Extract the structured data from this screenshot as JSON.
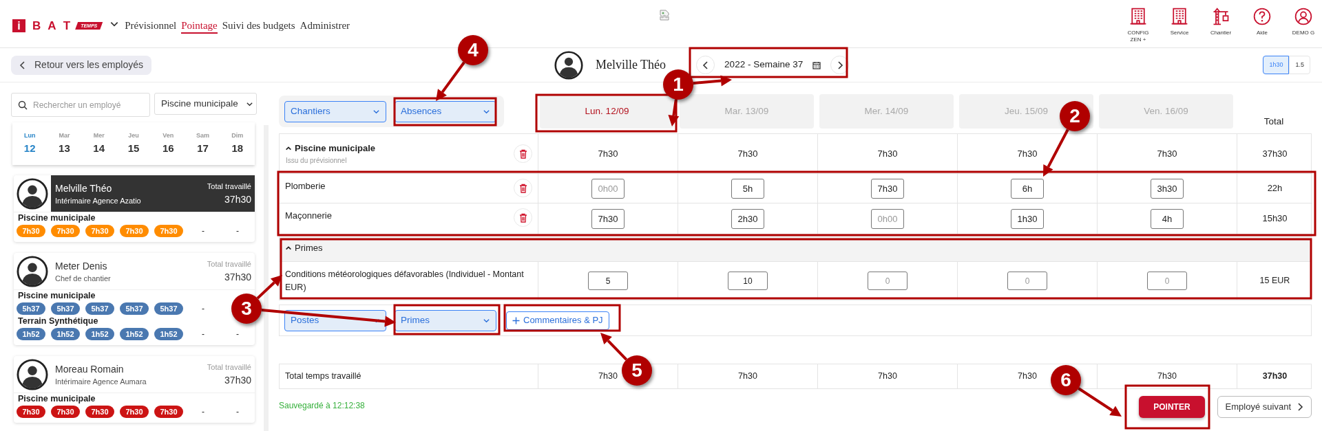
{
  "header": {
    "logo": {
      "letter": "i",
      "text": "B A T",
      "tag": "TEMPS"
    },
    "nav": [
      {
        "label": "Prévisionnel",
        "selected": false
      },
      {
        "label": "Pointage",
        "selected": true
      },
      {
        "label": "Suivi des budgets",
        "selected": false
      },
      {
        "label": "Administrer",
        "selected": false
      }
    ],
    "shortcuts": [
      {
        "label": "CONFIG ZEN +",
        "kind": "building"
      },
      {
        "label": "Service",
        "kind": "building"
      },
      {
        "label": "Chantier",
        "kind": "crane"
      },
      {
        "label": "Aide",
        "kind": "help"
      },
      {
        "label": "DEMO G",
        "kind": "user"
      }
    ]
  },
  "back_button": "Retour vers les employés",
  "employee_name": "Melville Théo",
  "week": "2022 - Semaine 37",
  "format_toggle": [
    {
      "label": "1h30",
      "selected": true
    },
    {
      "label": "1.5",
      "selected": false
    }
  ],
  "sidebar": {
    "search": {
      "placeholder": "Rechercher un employé"
    },
    "site_filter": "Piscine municipale",
    "days": [
      {
        "day": "Lun",
        "date": "12",
        "selected": true
      },
      {
        "day": "Mar",
        "date": "13",
        "selected": false
      },
      {
        "day": "Mer",
        "date": "14",
        "selected": false
      },
      {
        "day": "Jeu",
        "date": "15",
        "selected": false
      },
      {
        "day": "Ven",
        "date": "16",
        "selected": false
      },
      {
        "day": "Sam",
        "date": "17",
        "selected": false
      },
      {
        "day": "Dim",
        "date": "18",
        "selected": false
      }
    ],
    "employees": [
      {
        "name": "Melville Théo",
        "role": "Intérimaire Agence Azatio",
        "total_label": "Total travaillé",
        "total": "37h30",
        "selected": true,
        "sites": [
          {
            "name": "Piscine municipale",
            "color": "#ff8c00",
            "hours": [
              "7h30",
              "7h30",
              "7h30",
              "7h30",
              "7h30"
            ],
            "weekend": [
              "-",
              "-"
            ]
          }
        ]
      },
      {
        "name": "Meter Denis",
        "role": "Chef de chantier",
        "total_label": "Total travaillé",
        "total": "37h30",
        "selected": false,
        "sites": [
          {
            "name": "Piscine municipale",
            "color": "#4a78b0",
            "hours": [
              "5h37",
              "5h37",
              "5h37",
              "5h37",
              "5h37"
            ],
            "weekend": [
              "-"
            ]
          },
          {
            "name": "Terrain Synthétique",
            "color": "#4a78b0",
            "hours": [
              "1h52",
              "1h52",
              "1h52",
              "1h52",
              "1h52"
            ],
            "weekend": [
              "-",
              "-"
            ]
          }
        ]
      },
      {
        "name": "Moreau Romain",
        "role": "Intérimaire Agence Aumara",
        "total_label": "Total travaillé",
        "total": "37h30",
        "selected": false,
        "sites": [
          {
            "name": "Piscine municipale",
            "color": "#cc1414",
            "hours": [
              "7h30",
              "7h30",
              "7h30",
              "7h30",
              "7h30"
            ],
            "weekend": [
              "-",
              "-"
            ]
          }
        ]
      }
    ]
  },
  "filters": [
    "Chantiers",
    "Absences"
  ],
  "day_headers": [
    {
      "label": "Lun. 12/09",
      "selected": true
    },
    {
      "label": "Mar. 13/09",
      "selected": false
    },
    {
      "label": "Mer. 14/09",
      "selected": false
    },
    {
      "label": "Jeu. 15/09",
      "selected": false
    },
    {
      "label": "Ven. 16/09",
      "selected": false
    }
  ],
  "total_header": "Total",
  "site_group": {
    "name": "Piscine municipale",
    "note": "Issu du prévisionnel",
    "expanded": true,
    "hours": [
      "7h30",
      "7h30",
      "7h30",
      "7h30",
      "7h30"
    ],
    "total": "37h30"
  },
  "tasks": [
    {
      "name": "Plomberie",
      "entries": [
        {
          "placeholder": "0h00"
        },
        {
          "value": "5h"
        },
        {
          "value": "7h30"
        },
        {
          "value": "6h"
        },
        {
          "value": "3h30"
        }
      ],
      "total": "22h"
    },
    {
      "name": "Maçonnerie",
      "entries": [
        {
          "value": "7h30"
        },
        {
          "value": "2h30"
        },
        {
          "placeholder": "0h00"
        },
        {
          "value": "1h30"
        },
        {
          "value": "4h"
        }
      ],
      "total": "15h30"
    }
  ],
  "primes": {
    "label": "Primes",
    "expanded": true,
    "rows": [
      {
        "name": "Conditions météorologiques défavorables (Individuel - Montant EUR)",
        "entries": [
          {
            "value": "5"
          },
          {
            "value": "10"
          },
          {
            "placeholder": "0"
          },
          {
            "placeholder": "0"
          },
          {
            "placeholder": "0"
          }
        ],
        "total": "15 EUR"
      }
    ]
  },
  "add_buttons": [
    {
      "label": "Postes",
      "kind": "dropdown"
    },
    {
      "label": "Primes",
      "kind": "dropdown"
    },
    {
      "label": "Commentaires & PJ",
      "kind": "add"
    }
  ],
  "total_row": {
    "label": "Total temps travaillé",
    "values": [
      "7h30",
      "7h30",
      "7h30",
      "7h30",
      "7h30"
    ],
    "total": "37h30"
  },
  "saved": "Sauvegardé à 12:12:38",
  "actions": {
    "primary": "POINTER",
    "next": "Employé suivant"
  },
  "annotations": [
    {
      "label": "1"
    },
    {
      "label": "2"
    },
    {
      "label": "3"
    },
    {
      "label": "4"
    },
    {
      "label": "5"
    },
    {
      "label": "6"
    }
  ]
}
